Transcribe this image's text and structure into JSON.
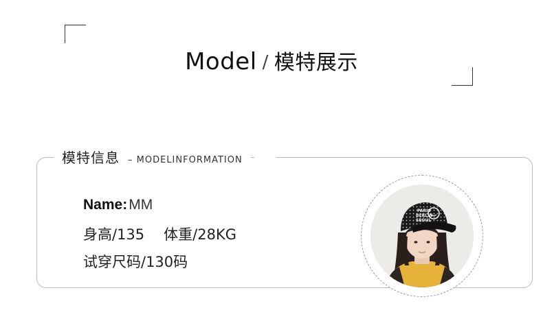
{
  "header": {
    "title_en": "Model",
    "separator": "/",
    "title_cn": "模特展示"
  },
  "card": {
    "label_cn": "模特信息",
    "label_en": "– MODELINFORMATION"
  },
  "model": {
    "name_label": "Name:",
    "name_value": "MM",
    "height_text": "身高/135",
    "weight_text": "体重/28KG",
    "size_text": "试穿尺码/130码"
  },
  "photo": {
    "alt": "model photo",
    "cap_print": [
      "PARIS",
      "BERLIN",
      "SEOUL"
    ]
  },
  "colors": {
    "border": "#b9b9b9",
    "text": "#222222",
    "cap": "#1a1a1a",
    "sweater": "#e6b23a"
  }
}
